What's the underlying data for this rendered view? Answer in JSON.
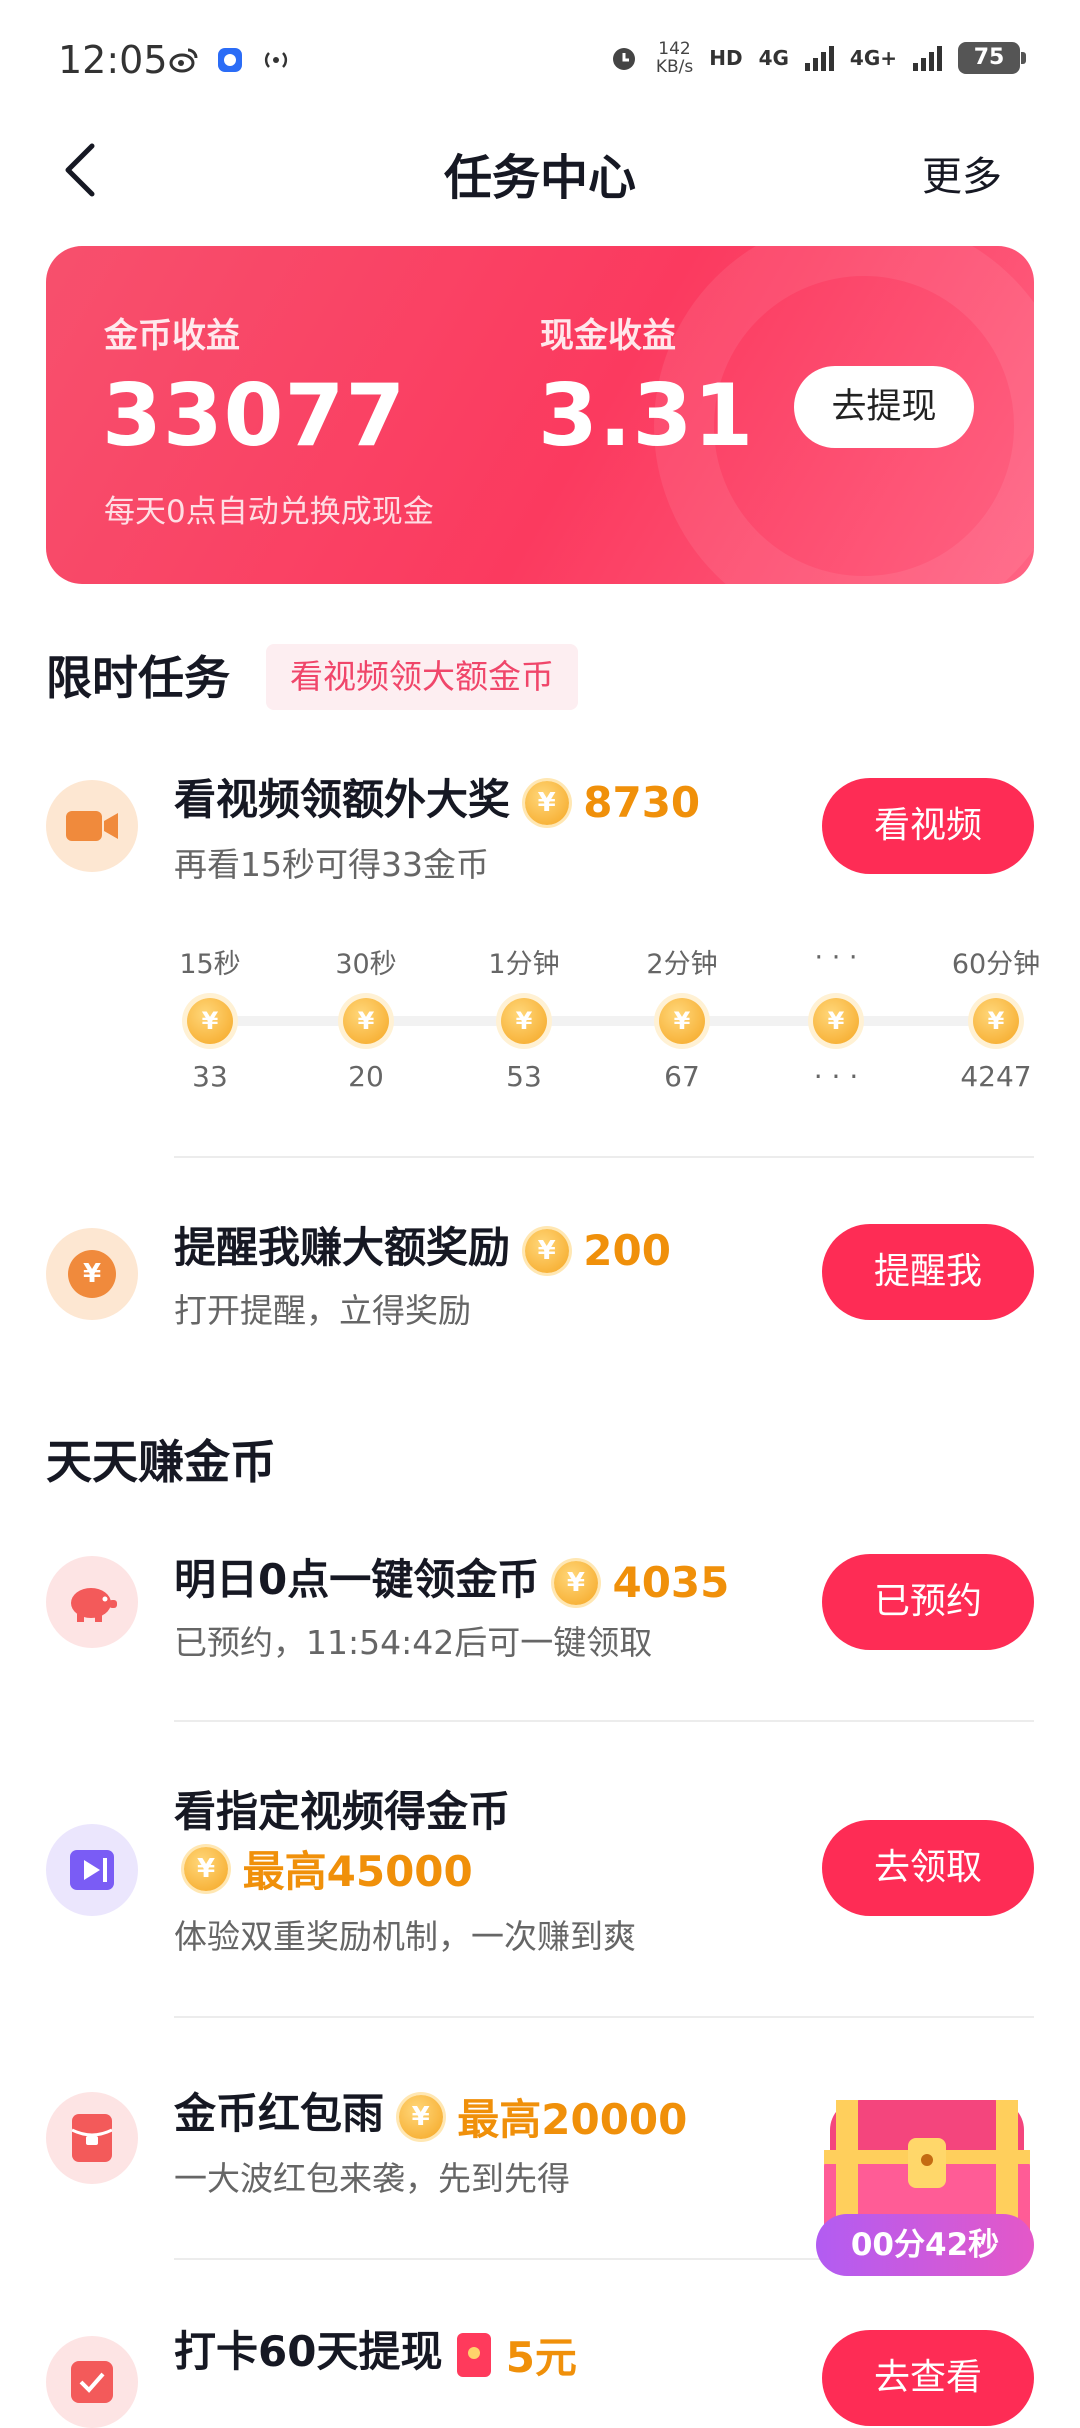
{
  "status_bar": {
    "time": "12:05",
    "speed_value": "142",
    "speed_unit": "KB/s",
    "hd_label": "HD",
    "net1": "4G",
    "net2": "4G+",
    "battery": "75"
  },
  "nav": {
    "title": "任务中心",
    "more": "更多"
  },
  "earnings": {
    "coin_label": "金币收益",
    "coin_value": "33077",
    "cash_label": "现金收益",
    "cash_value": "3.31",
    "withdraw_button": "去提现",
    "tip": "每天0点自动兑换成现金"
  },
  "limited": {
    "title": "限时任务",
    "tag": "看视频领大额金币",
    "video_task": {
      "title": "看视频领额外大奖",
      "amount": "8730",
      "subtitle": "再看15秒可得33金币",
      "button": "看视频"
    },
    "timeline": [
      {
        "label": "15秒",
        "value": "33"
      },
      {
        "label": "30秒",
        "value": "20"
      },
      {
        "label": "1分钟",
        "value": "53"
      },
      {
        "label": "2分钟",
        "value": "67"
      },
      {
        "label": "· · ·",
        "value": "· · ·"
      },
      {
        "label": "60分钟",
        "value": "4247"
      }
    ],
    "remind_task": {
      "title": "提醒我赚大额奖励",
      "amount": "200",
      "subtitle": "打开提醒，立得奖励",
      "button": "提醒我"
    }
  },
  "daily": {
    "title": "天天赚金币",
    "tasks": [
      {
        "title": "明日0点一键领金币",
        "amount": "4035",
        "subtitle": "已预约，11:54:42后可一键领取",
        "button": "已预约"
      },
      {
        "title": "看指定视频得金币",
        "amount": "最高45000",
        "subtitle": "体验双重奖励机制，一次赚到爽",
        "button": "去领取"
      },
      {
        "title": "金币红包雨",
        "amount": "最高20000",
        "subtitle": "一大波红包来袭，先到先得",
        "button": ""
      },
      {
        "title": "打卡60天提现",
        "amount": "5元",
        "subtitle": "",
        "button": "去查看"
      }
    ]
  },
  "chest": {
    "timer": "00分42秒"
  },
  "colors": {
    "accent": "#fe2c55",
    "coin": "#f0900a"
  }
}
